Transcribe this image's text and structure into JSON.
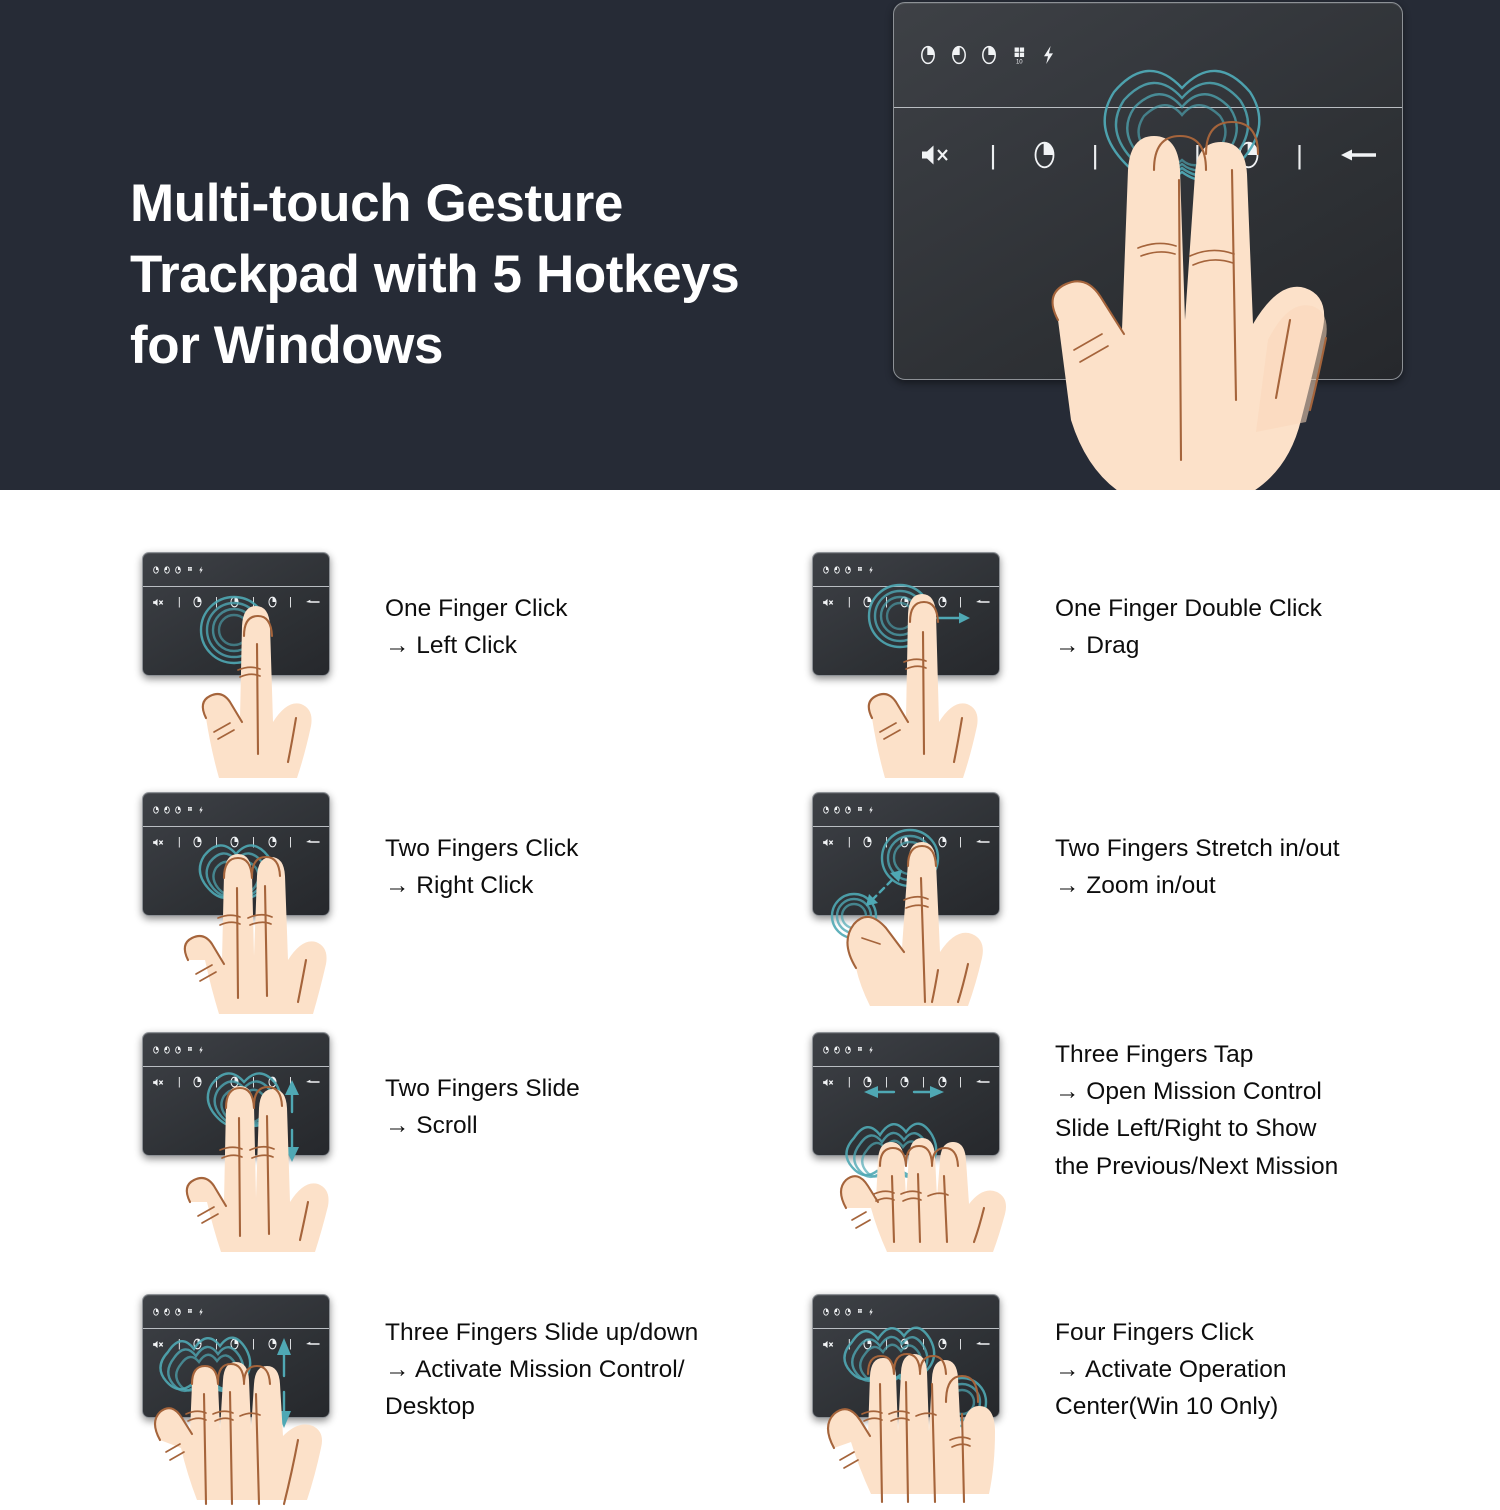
{
  "hero": {
    "title": "Multi-touch Gesture\nTrackpad with 5 Hotkeys\nfor Windows",
    "bg_color": "#262b36",
    "title_color": "#ffffff",
    "device": {
      "name": "trackpad-device",
      "led_indicators": [
        "mouse-icon",
        "mouse-icon",
        "mouse-icon",
        "windows-10-icon",
        "lightning-bolt-icon"
      ],
      "hotkeys": [
        "mute-icon",
        "separator",
        "mouse-icon",
        "separator",
        "mouse-icon",
        "separator",
        "mouse-icon",
        "separator",
        "enter-arrow-icon"
      ],
      "hotkey_count_label": "5 Hotkeys"
    },
    "hand": "two-finger-hand-illustration",
    "ripple_color": "#4fa8b4"
  },
  "gestures": [
    {
      "id": "one-finger-click",
      "figure": "one-finger-click-illustration",
      "fingers": 1,
      "text": "One Finger Click\n→  Left Click",
      "action_title": "One Finger Click",
      "action_result": "Left Click",
      "arrow": "none"
    },
    {
      "id": "one-finger-double-click",
      "figure": "one-finger-double-click-illustration",
      "fingers": 1,
      "text": "One Finger Double Click\n→ Drag",
      "action_title": "One Finger Double Click",
      "action_result": "Drag",
      "arrow": "right"
    },
    {
      "id": "two-fingers-click",
      "figure": "two-fingers-click-illustration",
      "fingers": 2,
      "text": "Two Fingers Click\n→  Right Click",
      "action_title": "Two Fingers Click",
      "action_result": "Right Click",
      "arrow": "none"
    },
    {
      "id": "two-fingers-stretch",
      "figure": "two-fingers-stretch-illustration",
      "fingers": 2,
      "text": "Two Fingers Stretch in/out\n→ Zoom in/out",
      "action_title": "Two Fingers Stretch in/out",
      "action_result": "Zoom in/out",
      "arrow": "diagonal-dashed"
    },
    {
      "id": "two-fingers-slide",
      "figure": "two-fingers-slide-illustration",
      "fingers": 2,
      "text": "Two Fingers Slide\n→  Scroll",
      "action_title": "Two Fingers Slide",
      "action_result": "Scroll",
      "arrow": "up-down"
    },
    {
      "id": "three-fingers-tap",
      "figure": "three-fingers-tap-illustration",
      "fingers": 3,
      "text": "Three Fingers Tap\n→  Open Mission Control\nSlide Left/Right to Show\nthe Previous/Next Mission",
      "action_title": "Three Fingers Tap",
      "action_result": "Open Mission Control Slide Left/Right to Show the Previous/Next Mission",
      "arrow": "left-right"
    },
    {
      "id": "three-fingers-slide",
      "figure": "three-fingers-slide-illustration",
      "fingers": 3,
      "text": "Three Fingers Slide up/down\n→  Activate Mission Control/\nDesktop",
      "action_title": "Three Fingers Slide up/down",
      "action_result": "Activate Mission Control/Desktop",
      "arrow": "up-down"
    },
    {
      "id": "four-fingers-click",
      "figure": "four-fingers-click-illustration",
      "fingers": 4,
      "text": "Four Fingers Click\n→  Activate Operation\nCenter(Win 10 Only)",
      "action_title": "Four Fingers Click",
      "action_result": "Activate Operation Center(Win 10 Only)",
      "arrow": "none"
    }
  ],
  "colors": {
    "hero_bg": "#262b36",
    "pad_dark": "#2e3135",
    "pad_border": "#8d9196",
    "skin": "#fce1c9",
    "skin_shadow": "#fad7ba",
    "outline": "#a5643b",
    "teal": "#4fa8b4",
    "text": "#0d0d0d",
    "page_bg": "#ffffff"
  }
}
